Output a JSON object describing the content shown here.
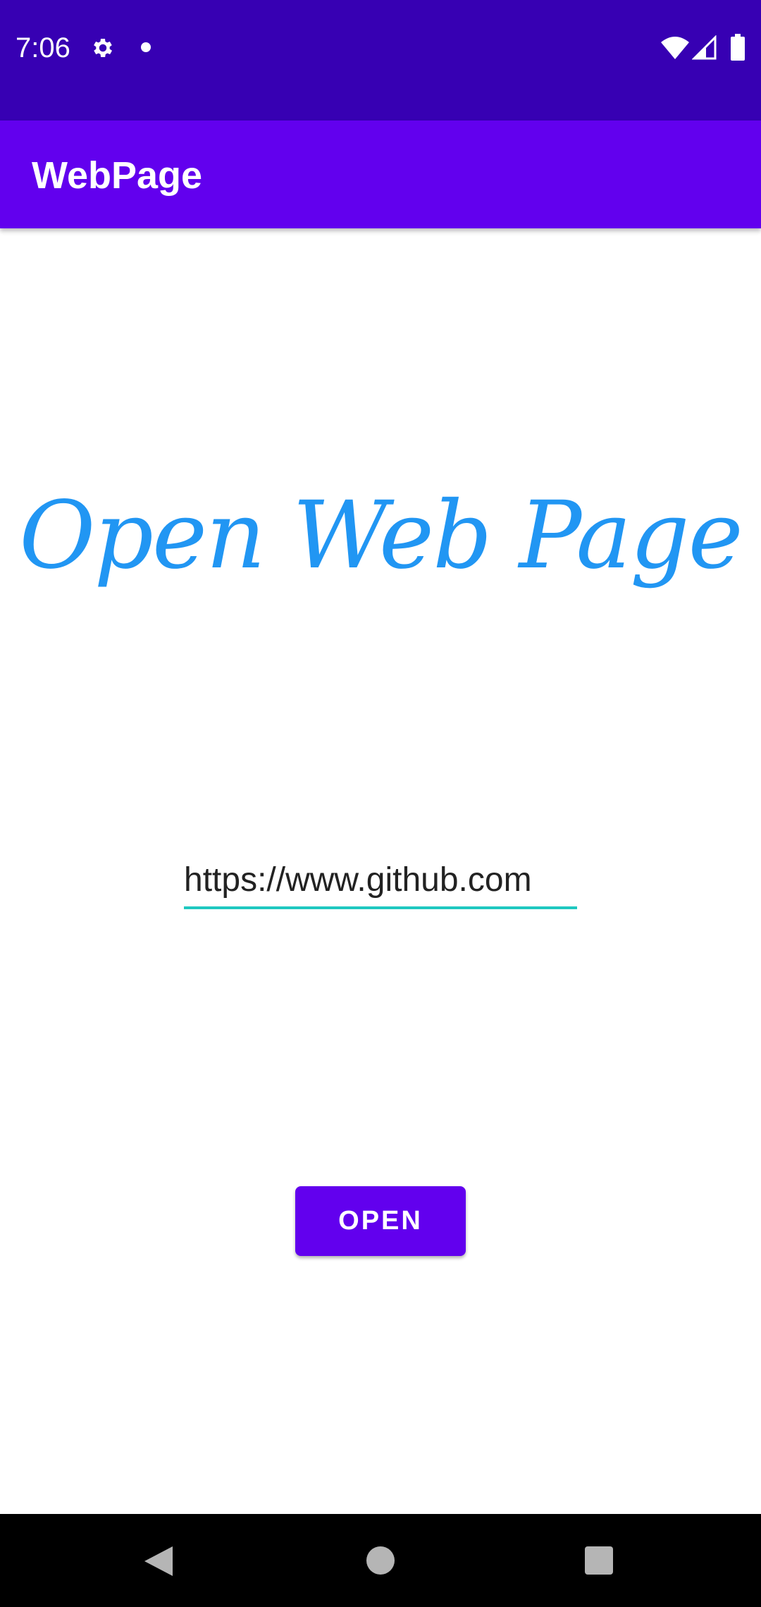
{
  "status_bar": {
    "time": "7:06",
    "icons": [
      "gear-icon",
      "notification-dot-icon",
      "wifi-icon",
      "signal-icon",
      "battery-icon"
    ],
    "background": "#3700B3"
  },
  "app_bar": {
    "title": "WebPage",
    "background": "#6200EE"
  },
  "main": {
    "headline": "Open Web Page",
    "headline_color": "#2196F3",
    "url_input": {
      "value": "https://www.github.com",
      "underline_color": "#1FC8C0"
    },
    "open_button": {
      "label": "OPEN",
      "background": "#6200EE"
    }
  },
  "nav_bar": {
    "icons": [
      "back-icon",
      "home-icon",
      "recents-icon"
    ]
  }
}
